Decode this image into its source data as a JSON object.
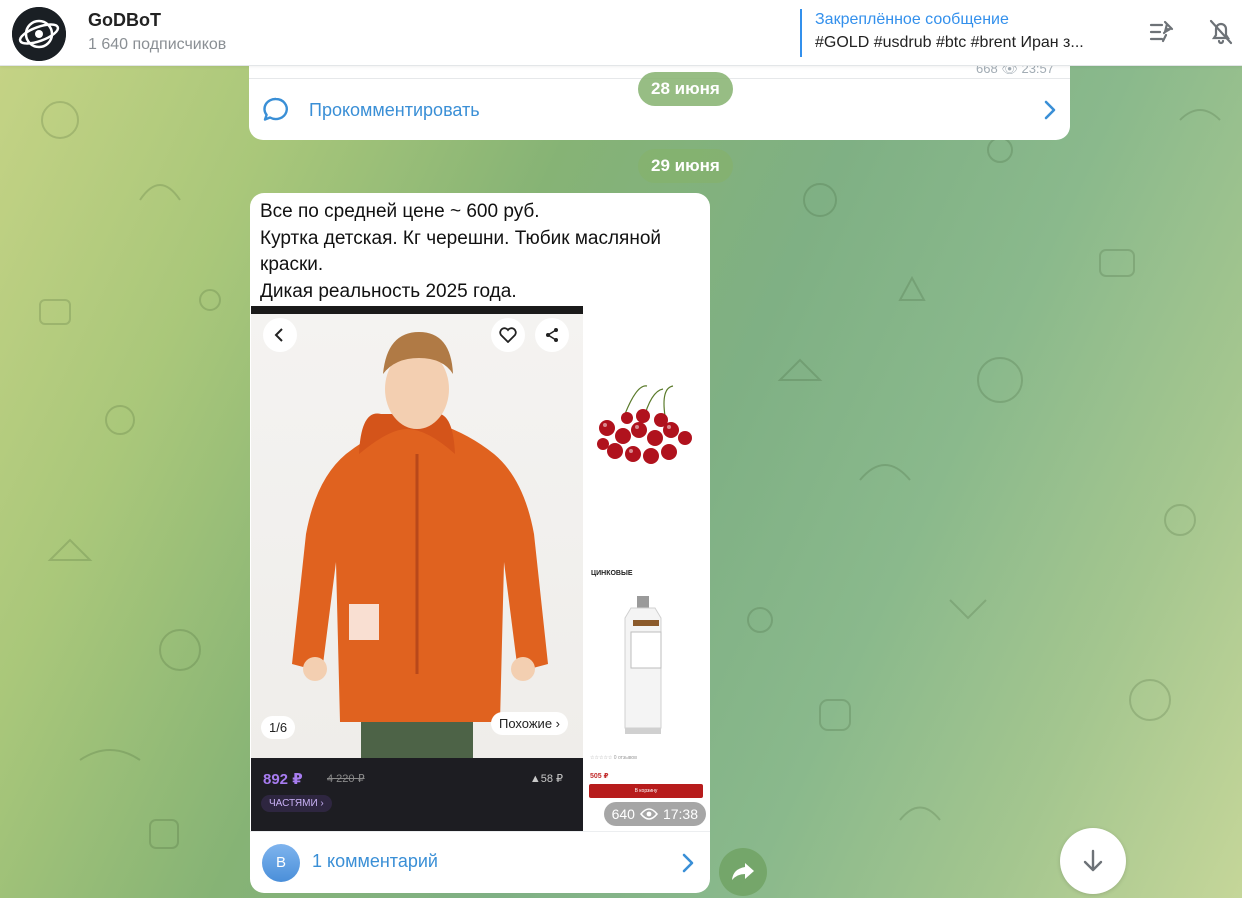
{
  "header": {
    "channel_title": "GoDBoT",
    "subscribers": "1 640 подписчиков",
    "pinned_title": "Закреплённое сообщение",
    "pinned_text": "#GOLD #usdrub #btc #brent Иран з..."
  },
  "prev_post": {
    "meta": "668 👁 23:57",
    "comment_label": "Прокомментировать"
  },
  "dates": {
    "first": "28 июня",
    "second": "29 июня"
  },
  "post": {
    "lines": [
      "Все по средней цене ~ 600 руб.",
      "Куртка детская. Кг черешни. Тюбик масляной краски.",
      "Дикая реальность 2025 года."
    ],
    "jacket": {
      "pager": "1/6",
      "similar": "Похожие ›",
      "price": "892 ₽",
      "old_price": "4 220 ₽",
      "rating": "▲58 ₽",
      "parts": "ЧАСТЯМИ ›"
    },
    "paint": {
      "title": "ЦИНКОВЫЕ",
      "rating": "☆☆☆☆☆ 0 отзывов",
      "price": "505 ₽",
      "button": "В корзину"
    },
    "views": "640",
    "time": "17:38",
    "comments_avatar": "В",
    "comments_label": "1 комментарий"
  },
  "icons": {
    "comment": "speech-bubble-icon",
    "share": "share-arrow-icon",
    "scroll": "arrow-down-icon",
    "pin": "pin-list-icon",
    "mute": "bell-muted-icon"
  },
  "colors": {
    "accent": "#3a8fd6",
    "date_pill": "#85b26e",
    "price_purple": "#a77cf0",
    "jacket_orange": "#e0621f"
  }
}
